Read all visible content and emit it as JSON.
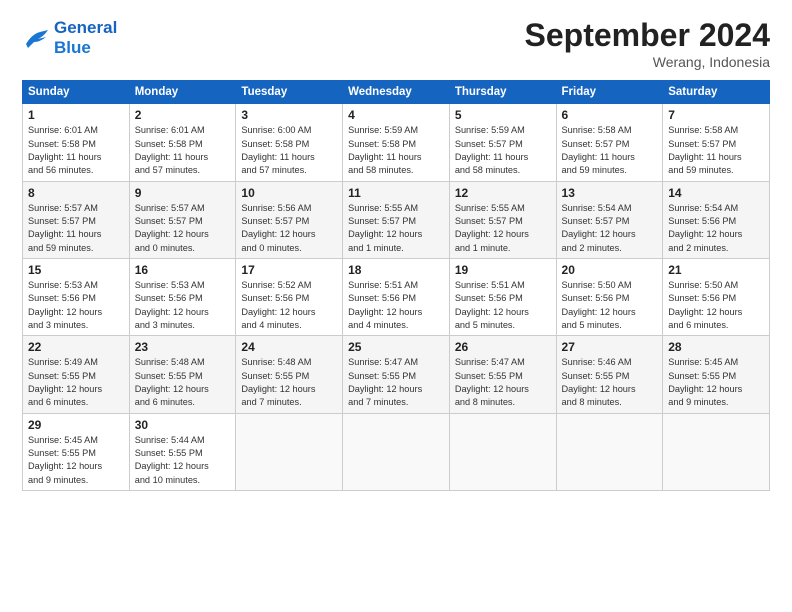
{
  "logo": {
    "line1": "General",
    "line2": "Blue"
  },
  "title": "September 2024",
  "location": "Werang, Indonesia",
  "days_header": [
    "Sunday",
    "Monday",
    "Tuesday",
    "Wednesday",
    "Thursday",
    "Friday",
    "Saturday"
  ],
  "weeks": [
    [
      {
        "day": "1",
        "text": "Sunrise: 6:01 AM\nSunset: 5:58 PM\nDaylight: 11 hours\nand 56 minutes."
      },
      {
        "day": "2",
        "text": "Sunrise: 6:01 AM\nSunset: 5:58 PM\nDaylight: 11 hours\nand 57 minutes."
      },
      {
        "day": "3",
        "text": "Sunrise: 6:00 AM\nSunset: 5:58 PM\nDaylight: 11 hours\nand 57 minutes."
      },
      {
        "day": "4",
        "text": "Sunrise: 5:59 AM\nSunset: 5:58 PM\nDaylight: 11 hours\nand 58 minutes."
      },
      {
        "day": "5",
        "text": "Sunrise: 5:59 AM\nSunset: 5:57 PM\nDaylight: 11 hours\nand 58 minutes."
      },
      {
        "day": "6",
        "text": "Sunrise: 5:58 AM\nSunset: 5:57 PM\nDaylight: 11 hours\nand 59 minutes."
      },
      {
        "day": "7",
        "text": "Sunrise: 5:58 AM\nSunset: 5:57 PM\nDaylight: 11 hours\nand 59 minutes."
      }
    ],
    [
      {
        "day": "8",
        "text": "Sunrise: 5:57 AM\nSunset: 5:57 PM\nDaylight: 11 hours\nand 59 minutes."
      },
      {
        "day": "9",
        "text": "Sunrise: 5:57 AM\nSunset: 5:57 PM\nDaylight: 12 hours\nand 0 minutes."
      },
      {
        "day": "10",
        "text": "Sunrise: 5:56 AM\nSunset: 5:57 PM\nDaylight: 12 hours\nand 0 minutes."
      },
      {
        "day": "11",
        "text": "Sunrise: 5:55 AM\nSunset: 5:57 PM\nDaylight: 12 hours\nand 1 minute."
      },
      {
        "day": "12",
        "text": "Sunrise: 5:55 AM\nSunset: 5:57 PM\nDaylight: 12 hours\nand 1 minute."
      },
      {
        "day": "13",
        "text": "Sunrise: 5:54 AM\nSunset: 5:57 PM\nDaylight: 12 hours\nand 2 minutes."
      },
      {
        "day": "14",
        "text": "Sunrise: 5:54 AM\nSunset: 5:56 PM\nDaylight: 12 hours\nand 2 minutes."
      }
    ],
    [
      {
        "day": "15",
        "text": "Sunrise: 5:53 AM\nSunset: 5:56 PM\nDaylight: 12 hours\nand 3 minutes."
      },
      {
        "day": "16",
        "text": "Sunrise: 5:53 AM\nSunset: 5:56 PM\nDaylight: 12 hours\nand 3 minutes."
      },
      {
        "day": "17",
        "text": "Sunrise: 5:52 AM\nSunset: 5:56 PM\nDaylight: 12 hours\nand 4 minutes."
      },
      {
        "day": "18",
        "text": "Sunrise: 5:51 AM\nSunset: 5:56 PM\nDaylight: 12 hours\nand 4 minutes."
      },
      {
        "day": "19",
        "text": "Sunrise: 5:51 AM\nSunset: 5:56 PM\nDaylight: 12 hours\nand 5 minutes."
      },
      {
        "day": "20",
        "text": "Sunrise: 5:50 AM\nSunset: 5:56 PM\nDaylight: 12 hours\nand 5 minutes."
      },
      {
        "day": "21",
        "text": "Sunrise: 5:50 AM\nSunset: 5:56 PM\nDaylight: 12 hours\nand 6 minutes."
      }
    ],
    [
      {
        "day": "22",
        "text": "Sunrise: 5:49 AM\nSunset: 5:55 PM\nDaylight: 12 hours\nand 6 minutes."
      },
      {
        "day": "23",
        "text": "Sunrise: 5:48 AM\nSunset: 5:55 PM\nDaylight: 12 hours\nand 6 minutes."
      },
      {
        "day": "24",
        "text": "Sunrise: 5:48 AM\nSunset: 5:55 PM\nDaylight: 12 hours\nand 7 minutes."
      },
      {
        "day": "25",
        "text": "Sunrise: 5:47 AM\nSunset: 5:55 PM\nDaylight: 12 hours\nand 7 minutes."
      },
      {
        "day": "26",
        "text": "Sunrise: 5:47 AM\nSunset: 5:55 PM\nDaylight: 12 hours\nand 8 minutes."
      },
      {
        "day": "27",
        "text": "Sunrise: 5:46 AM\nSunset: 5:55 PM\nDaylight: 12 hours\nand 8 minutes."
      },
      {
        "day": "28",
        "text": "Sunrise: 5:45 AM\nSunset: 5:55 PM\nDaylight: 12 hours\nand 9 minutes."
      }
    ],
    [
      {
        "day": "29",
        "text": "Sunrise: 5:45 AM\nSunset: 5:55 PM\nDaylight: 12 hours\nand 9 minutes."
      },
      {
        "day": "30",
        "text": "Sunrise: 5:44 AM\nSunset: 5:55 PM\nDaylight: 12 hours\nand 10 minutes."
      },
      {
        "day": "",
        "text": ""
      },
      {
        "day": "",
        "text": ""
      },
      {
        "day": "",
        "text": ""
      },
      {
        "day": "",
        "text": ""
      },
      {
        "day": "",
        "text": ""
      }
    ]
  ]
}
